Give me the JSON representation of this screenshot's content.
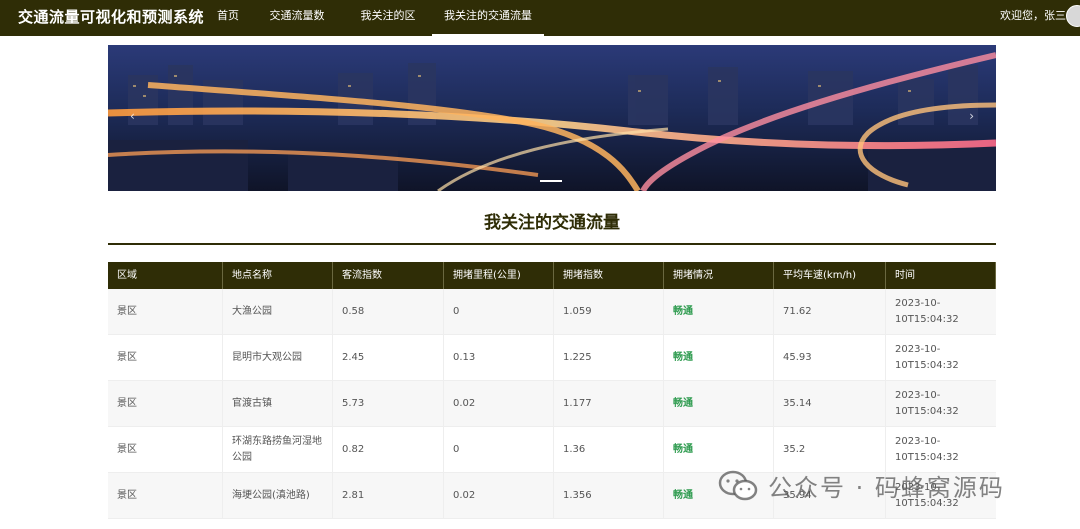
{
  "app": {
    "title": "交通流量可视化和预测系统"
  },
  "nav": {
    "items": [
      {
        "label": "首页"
      },
      {
        "label": "交通流量数据"
      },
      {
        "label": "我关注的区域"
      },
      {
        "label": "我关注的交通流量"
      }
    ],
    "welcome": "欢迎您，张三"
  },
  "carousel": {
    "prev_icon": "chevron-left-icon",
    "next_icon": "chevron-right-icon",
    "prev": "‹",
    "next": "›"
  },
  "page": {
    "title": "我关注的交通流量"
  },
  "table": {
    "headers": [
      "区域",
      "地点名称",
      "客流指数",
      "拥堵里程(公里)",
      "拥堵指数",
      "拥堵情况",
      "平均车速(km/h)",
      "时间"
    ],
    "rows": [
      [
        "景区",
        "大渔公园",
        "0.58",
        "0",
        "1.059",
        "畅通",
        "71.62",
        "2023-10-10T15:04:32"
      ],
      [
        "景区",
        "昆明市大观公园",
        "2.45",
        "0.13",
        "1.225",
        "畅通",
        "45.93",
        "2023-10-10T15:04:32"
      ],
      [
        "景区",
        "官渡古镇",
        "5.73",
        "0.02",
        "1.177",
        "畅通",
        "35.14",
        "2023-10-10T15:04:32"
      ],
      [
        "景区",
        "环湖东路捞鱼河湿地公园",
        "0.82",
        "0",
        "1.36",
        "畅通",
        "35.2",
        "2023-10-10T15:04:32"
      ],
      [
        "景区",
        "海埂公园(滇池路)",
        "2.81",
        "0.02",
        "1.356",
        "畅通",
        "35.94",
        "2023-10-10T15:04:32"
      ]
    ]
  },
  "colors": {
    "nav_bg": "#2f2d06",
    "status_good": "#2e9b4f"
  },
  "watermark": {
    "text": "公众号 · 码蜂窝源码",
    "icon": "wechat-icon"
  }
}
